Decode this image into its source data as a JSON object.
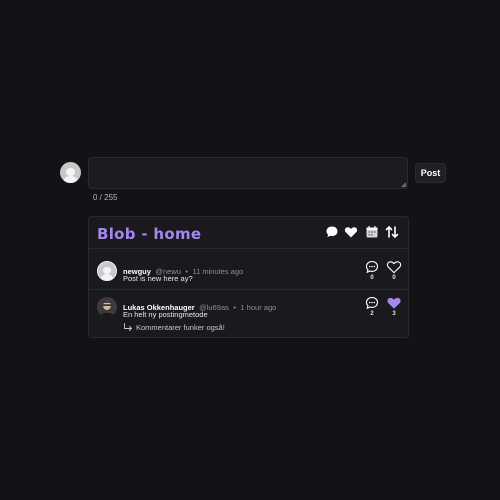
{
  "composer": {
    "char_count": "0 / 255",
    "post_label": "Post"
  },
  "feed": {
    "title": "Blob - home",
    "header_icons": [
      "chat-bubble-icon",
      "heart-icon",
      "calendar-icon",
      "sort-arrows-icon"
    ],
    "posts": [
      {
        "author": "newguy",
        "handle": "@newu",
        "separator": "•",
        "time": "11 minutes ago",
        "body": "Post is new here ay?",
        "comment_count": "0",
        "like_count": "0",
        "liked": false
      },
      {
        "author": "Lukas Okkenhauger",
        "handle": "@lu69as",
        "separator": "•",
        "time": "1 hour ago",
        "body": "En helt ny postingmetode",
        "reply": "Kommentarer funker også!",
        "comment_count": "2",
        "like_count": "3",
        "liked": true
      }
    ]
  },
  "colors": {
    "background": "#141217",
    "accent": "#a486f0",
    "card": "#1b191e"
  }
}
